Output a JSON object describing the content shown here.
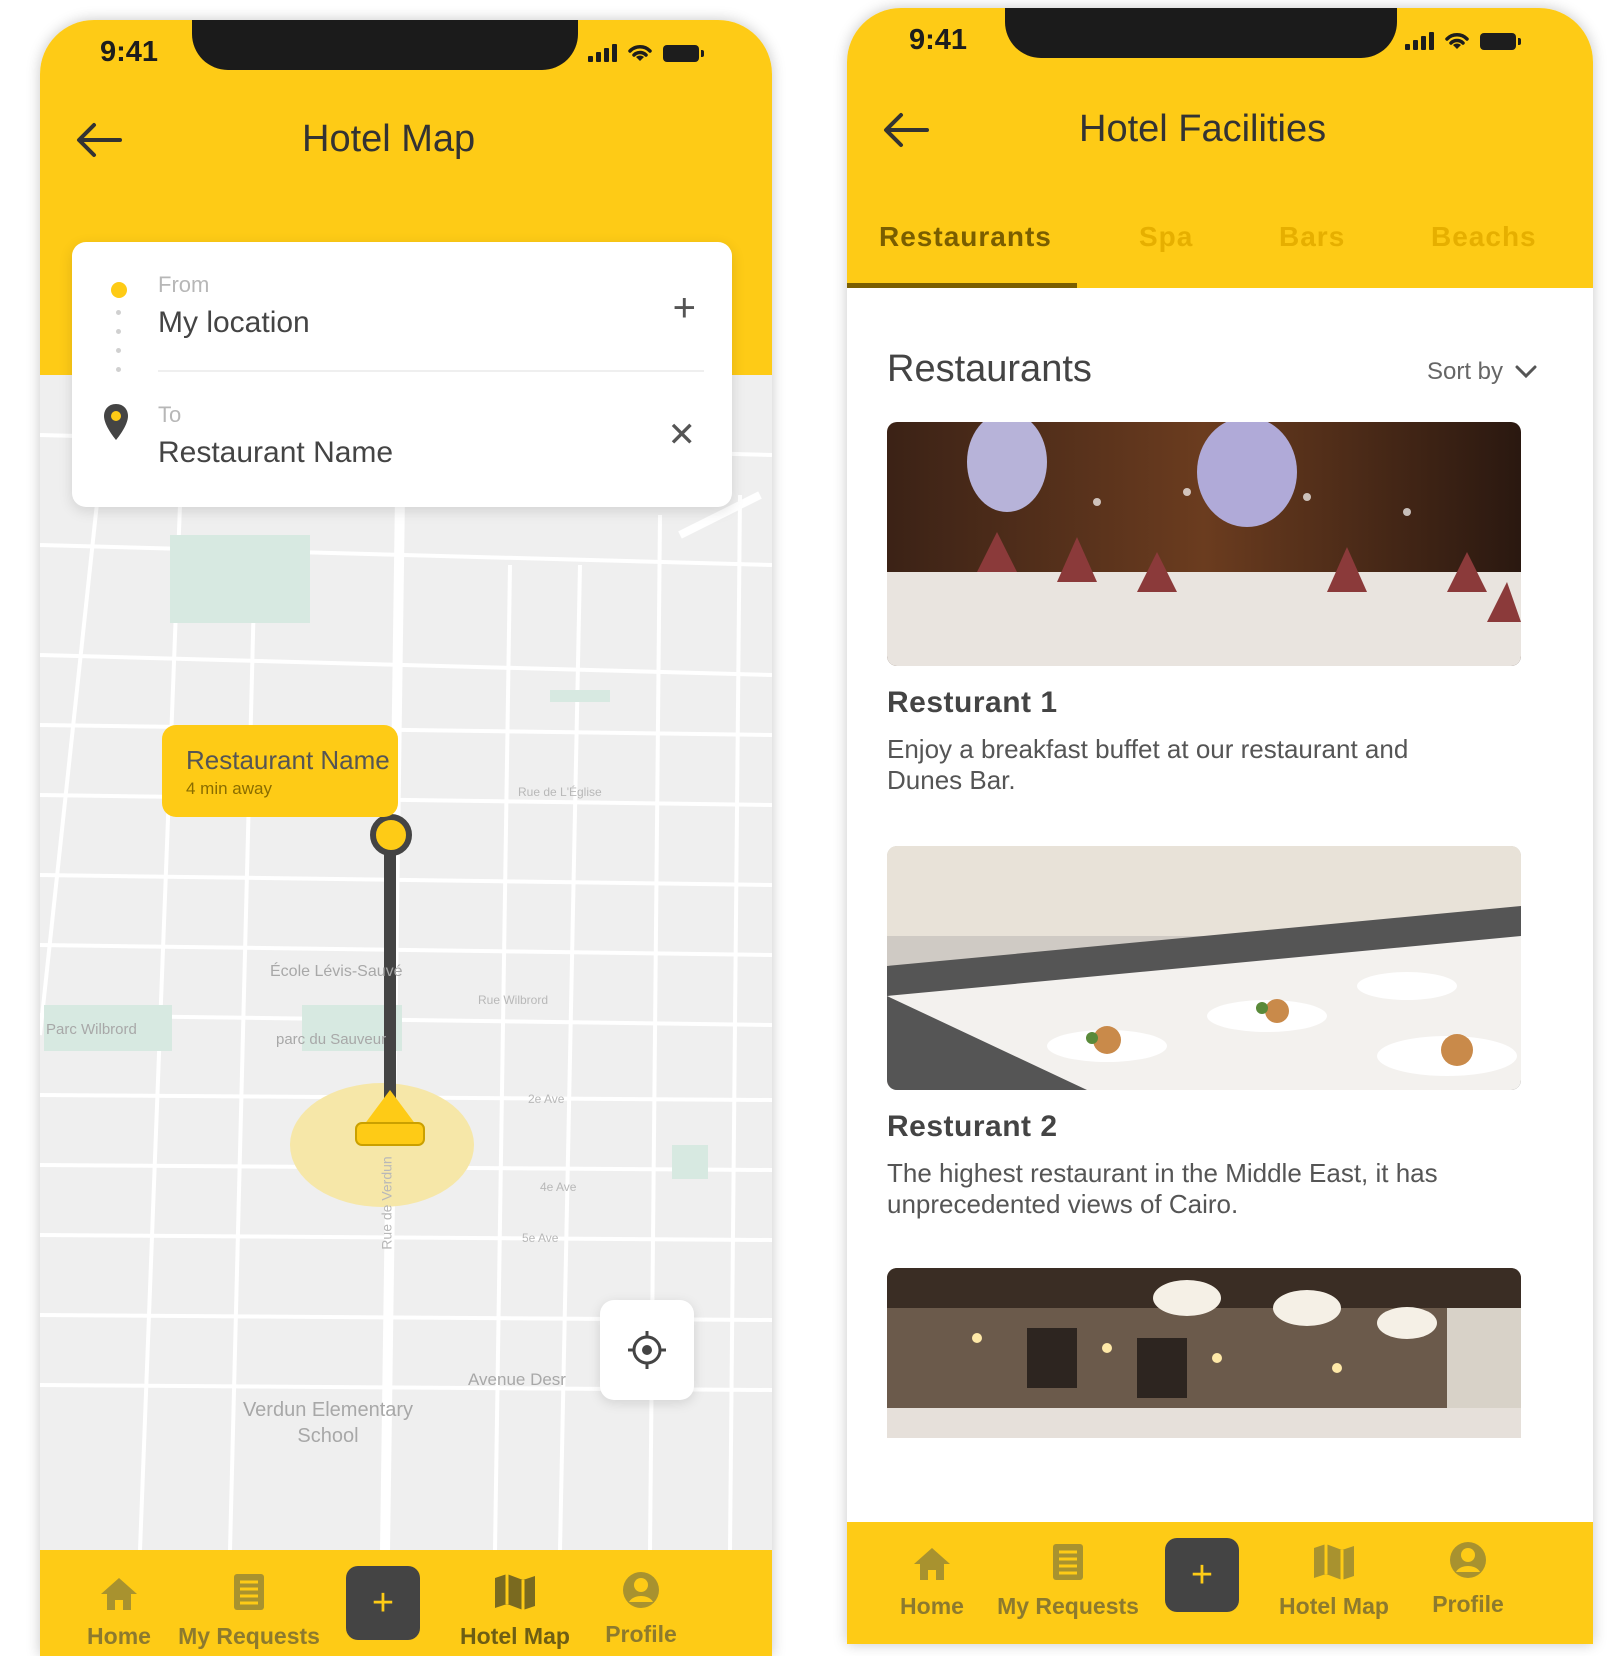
{
  "left_screen": {
    "status_time": "9:41",
    "title": "Hotel Map",
    "route": {
      "from_label": "From",
      "from_value": "My location",
      "to_label": "To",
      "to_value": "Restaurant Name"
    },
    "callout": {
      "name": "Restaurant Name",
      "eta": "4 min away"
    },
    "map_labels": {
      "school": "Verdun Elementary School",
      "avenue": "Avenue Desr",
      "parc": "Parc Wilbrord",
      "ecole": "École Lévis-Sauvé",
      "parc_sauveur": "parc du Sauveur",
      "rue_eglise": "Rue de L'Église",
      "rue_wilbrord": "Rue Wilbrord",
      "second_ave": "2e Ave",
      "fourth_ave": "4e Ave",
      "fifth_ave": "5e Ave",
      "rue_de_verdun": "Rue de Verdun"
    },
    "nav": {
      "home": "Home",
      "requests": "My Requests",
      "add": "+",
      "map": "Hotel Map",
      "profile": "Profile"
    }
  },
  "right_screen": {
    "status_time": "9:41",
    "title": "Hotel Facilities",
    "tabs": [
      "Restaurants",
      "Spa",
      "Bars",
      "Beachs"
    ],
    "section_title": "Restaurants",
    "sort_label": "Sort by",
    "cards": [
      {
        "title": "Resturant 1",
        "desc": "Enjoy a breakfast buffet at our restaurant and Dunes Bar."
      },
      {
        "title": "Resturant 2",
        "desc": "The highest restaurant in the Middle East, it has unprecedented views of Cairo."
      }
    ],
    "nav": {
      "home": "Home",
      "requests": "My Requests",
      "add": "+",
      "map": "Hotel Map",
      "profile": "Profile"
    }
  },
  "colors": {
    "accent": "#FECB16",
    "dark": "#444444"
  }
}
